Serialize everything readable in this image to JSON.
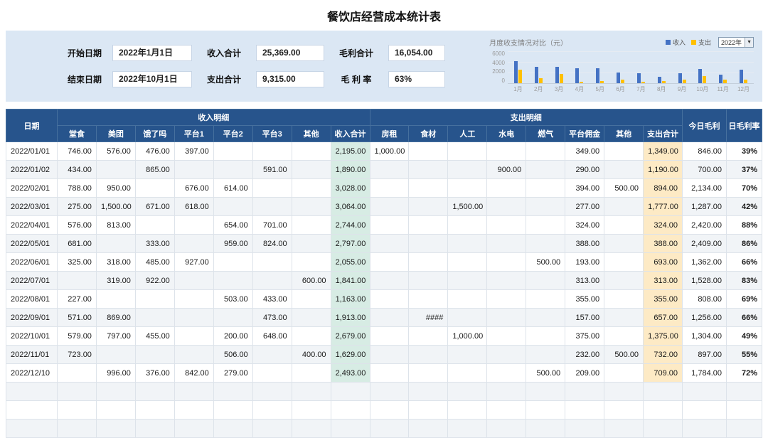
{
  "title": "餐饮店经营成本统计表",
  "summary": {
    "start_date": {
      "label": "开始日期",
      "value": "2022年1月1日"
    },
    "end_date": {
      "label": "结束日期",
      "value": "2022年10月1日"
    },
    "income_total": {
      "label": "收入合计",
      "value": "25,369.00"
    },
    "expense_total": {
      "label": "支出合计",
      "value": "9,315.00"
    },
    "profit_total": {
      "label": "毛利合计",
      "value": "16,054.00"
    },
    "profit_margin": {
      "label": "毛 利 率",
      "value": "63%"
    }
  },
  "chart": {
    "type": "bar",
    "title": "月度收支情况对比（元）",
    "legend": [
      {
        "label": "收入",
        "color": "#4472c4"
      },
      {
        "label": "支出",
        "color": "#ffc000"
      }
    ],
    "year_selector": "2022年",
    "y_max": 6000,
    "y_ticks": [
      "6000",
      "4000",
      "2000",
      "0"
    ],
    "months": [
      {
        "label": "1月",
        "income": 4085,
        "expense": 2539
      },
      {
        "label": "2月",
        "income": 3028,
        "expense": 894
      },
      {
        "label": "3月",
        "income": 3064,
        "expense": 1777
      },
      {
        "label": "4月",
        "income": 2744,
        "expense": 324
      },
      {
        "label": "5月",
        "income": 2797,
        "expense": 388
      },
      {
        "label": "6月",
        "income": 2055,
        "expense": 693
      },
      {
        "label": "7月",
        "income": 1841,
        "expense": 313
      },
      {
        "label": "8月",
        "income": 1163,
        "expense": 355
      },
      {
        "label": "9月",
        "income": 1913,
        "expense": 657
      },
      {
        "label": "10月",
        "income": 2679,
        "expense": 1375
      },
      {
        "label": "11月",
        "income": 1629,
        "expense": 732
      },
      {
        "label": "12月",
        "income": 2493,
        "expense": 709
      }
    ]
  },
  "table": {
    "date_header": "日期",
    "income_group": "收入明细",
    "expense_group": "支出明细",
    "profit_header": "今日毛利",
    "margin_header": "日毛利率",
    "income_cols": [
      "堂食",
      "美团",
      "饿了吗",
      "平台1",
      "平台2",
      "平台3",
      "其他",
      "收入合计"
    ],
    "expense_cols": [
      "房租",
      "食材",
      "人工",
      "水电",
      "燃气",
      "平台佣金",
      "其他",
      "支出合计"
    ],
    "empty_rows": 3,
    "rows": [
      {
        "date": "2022/01/01",
        "income": [
          "746.00",
          "576.00",
          "476.00",
          "397.00",
          "",
          "",
          "",
          "2,195.00"
        ],
        "expense": [
          "1,000.00",
          "",
          "",
          "",
          "",
          "349.00",
          "",
          "1,349.00"
        ],
        "profit": "846.00",
        "margin": "39%"
      },
      {
        "date": "2022/01/02",
        "income": [
          "434.00",
          "",
          "865.00",
          "",
          "",
          "591.00",
          "",
          "1,890.00"
        ],
        "expense": [
          "",
          "",
          "",
          "900.00",
          "",
          "290.00",
          "",
          "1,190.00"
        ],
        "profit": "700.00",
        "margin": "37%"
      },
      {
        "date": "2022/02/01",
        "income": [
          "788.00",
          "950.00",
          "",
          "676.00",
          "614.00",
          "",
          "",
          "3,028.00"
        ],
        "expense": [
          "",
          "",
          "",
          "",
          "",
          "394.00",
          "500.00",
          "894.00"
        ],
        "profit": "2,134.00",
        "margin": "70%"
      },
      {
        "date": "2022/03/01",
        "income": [
          "275.00",
          "1,500.00",
          "671.00",
          "618.00",
          "",
          "",
          "",
          "3,064.00"
        ],
        "expense": [
          "",
          "",
          "1,500.00",
          "",
          "",
          "277.00",
          "",
          "1,777.00"
        ],
        "profit": "1,287.00",
        "margin": "42%"
      },
      {
        "date": "2022/04/01",
        "income": [
          "576.00",
          "813.00",
          "",
          "",
          "654.00",
          "701.00",
          "",
          "2,744.00"
        ],
        "expense": [
          "",
          "",
          "",
          "",
          "",
          "324.00",
          "",
          "324.00"
        ],
        "profit": "2,420.00",
        "margin": "88%"
      },
      {
        "date": "2022/05/01",
        "income": [
          "681.00",
          "",
          "333.00",
          "",
          "959.00",
          "824.00",
          "",
          "2,797.00"
        ],
        "expense": [
          "",
          "",
          "",
          "",
          "",
          "388.00",
          "",
          "388.00"
        ],
        "profit": "2,409.00",
        "margin": "86%"
      },
      {
        "date": "2022/06/01",
        "income": [
          "325.00",
          "318.00",
          "485.00",
          "927.00",
          "",
          "",
          "",
          "2,055.00"
        ],
        "expense": [
          "",
          "",
          "",
          "",
          "500.00",
          "193.00",
          "",
          "693.00"
        ],
        "profit": "1,362.00",
        "margin": "66%"
      },
      {
        "date": "2022/07/01",
        "income": [
          "",
          "319.00",
          "922.00",
          "",
          "",
          "",
          "600.00",
          "1,841.00"
        ],
        "expense": [
          "",
          "",
          "",
          "",
          "",
          "313.00",
          "",
          "313.00"
        ],
        "profit": "1,528.00",
        "margin": "83%"
      },
      {
        "date": "2022/08/01",
        "income": [
          "227.00",
          "",
          "",
          "",
          "503.00",
          "433.00",
          "",
          "1,163.00"
        ],
        "expense": [
          "",
          "",
          "",
          "",
          "",
          "355.00",
          "",
          "355.00"
        ],
        "profit": "808.00",
        "margin": "69%"
      },
      {
        "date": "2022/09/01",
        "income": [
          "571.00",
          "869.00",
          "",
          "",
          "",
          "473.00",
          "",
          "1,913.00"
        ],
        "expense": [
          "",
          "####",
          "",
          "",
          "",
          "157.00",
          "",
          "657.00"
        ],
        "profit": "1,256.00",
        "margin": "66%"
      },
      {
        "date": "2022/10/01",
        "income": [
          "579.00",
          "797.00",
          "455.00",
          "",
          "200.00",
          "648.00",
          "",
          "2,679.00"
        ],
        "expense": [
          "",
          "",
          "1,000.00",
          "",
          "",
          "375.00",
          "",
          "1,375.00"
        ],
        "profit": "1,304.00",
        "margin": "49%"
      },
      {
        "date": "2022/11/01",
        "income": [
          "723.00",
          "",
          "",
          "",
          "506.00",
          "",
          "400.00",
          "1,629.00"
        ],
        "expense": [
          "",
          "",
          "",
          "",
          "",
          "232.00",
          "500.00",
          "732.00"
        ],
        "profit": "897.00",
        "margin": "55%"
      },
      {
        "date": "2022/12/10",
        "income": [
          "",
          "996.00",
          "376.00",
          "842.00",
          "279.00",
          "",
          "",
          "2,493.00"
        ],
        "expense": [
          "",
          "",
          "",
          "",
          "500.00",
          "209.00",
          "",
          "709.00"
        ],
        "profit": "1,784.00",
        "margin": "72%"
      }
    ]
  }
}
